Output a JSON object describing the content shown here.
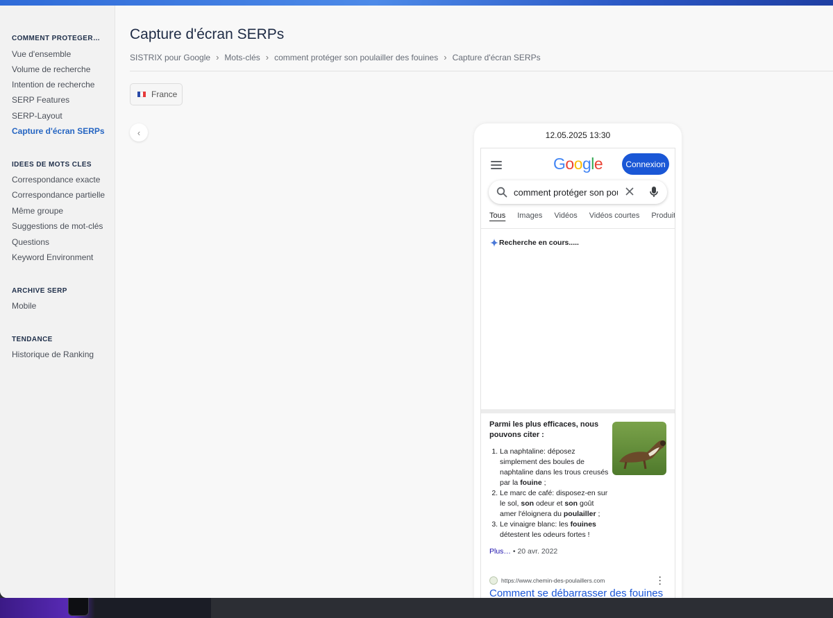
{
  "sidebar": {
    "sections": [
      {
        "title": "COMMENT PROTÉGER S…",
        "items": [
          "Vue d'ensemble",
          "Volume de recherche",
          "Intention de recherche",
          "SERP Features",
          "SERP-Layout",
          "Capture d'écran SERPs"
        ]
      },
      {
        "title": "IDÉES DE MOTS CLÉS",
        "items": [
          "Correspondance exacte",
          "Correspondance partielle",
          "Même groupe",
          "Suggestions de mot-clés",
          "Questions",
          "Keyword Environment"
        ]
      },
      {
        "title": "ARCHIVE SERP",
        "items": [
          "Mobile"
        ]
      },
      {
        "title": "TENDANCE",
        "items": [
          "Historique de Ranking"
        ]
      }
    ],
    "active_item": "Capture d'écran SERPs"
  },
  "main": {
    "title": "Capture d'écran SERPs",
    "breadcrumb": [
      "SISTRIX pour Google",
      "Mots-clés",
      "comment protéger son poulailler des fouines",
      "Capture d'écran SERPs"
    ],
    "country": "France",
    "flag_colors": [
      "#2a4aa8",
      "#ffffff",
      "#e63b3b"
    ]
  },
  "screenshot": {
    "timestamp": "12.05.2025 13:30",
    "google": {
      "login_label": "Connexion",
      "query": "comment protéger son pou",
      "tabs": [
        "Tous",
        "Images",
        "Vidéos",
        "Vidéos courtes",
        "Produit"
      ],
      "loading": "Recherche en cours.....",
      "snippet": {
        "title": "Parmi les plus efficaces, nous pouvons citer :",
        "items": [
          "La naphtaline: déposez simplement des boules de naphtaline dans les trous creusés par la fouine ;",
          "Le marc de café: disposez-en sur le sol, son odeur et son goût amer l'éloignera du poulailler ;",
          "Le vinaigre blanc: les fouines détestent les odeurs fortes !"
        ],
        "more": "Plus…",
        "date": "20 avr. 2022"
      },
      "result": {
        "url": "https://www.chemin-des-poulaillers.com",
        "title": "Comment se débarrasser des fouines"
      }
    }
  },
  "colors": {
    "accent": "#2565c2",
    "google_button": "#1a57d6",
    "link": "#1a56d6"
  }
}
